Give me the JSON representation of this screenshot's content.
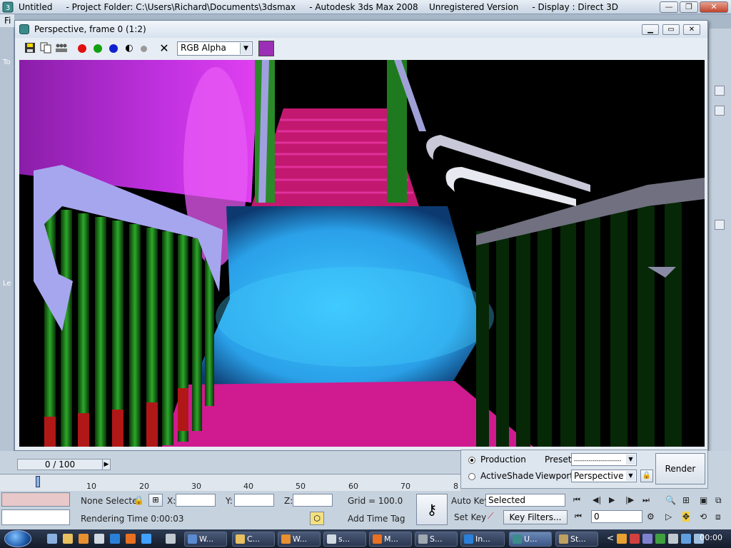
{
  "main_window": {
    "title": "Untitled     - Project Folder: C:\\Users\\Richard\\Documents\\3dsmax     - Autodesk 3ds Max 2008    Unregistered Version     - Display : Direct 3D",
    "menu_stub": "Fi"
  },
  "left_strip_marks": [
    "To",
    "Le"
  ],
  "frame_window": {
    "title": "Perspective, frame 0 (1:2)",
    "channel_select": "RGB Alpha",
    "swatch_color": "#9b2fb5"
  },
  "timeline": {
    "slider_text": "0 / 100",
    "ruler_ticks": [
      "10",
      "20",
      "30",
      "40",
      "50",
      "60",
      "70"
    ],
    "ruler_edge_label": "8"
  },
  "render_panel": {
    "production_label": "Production",
    "activeshade_label": "ActiveShade",
    "preset_label": "Preset:",
    "preset_value": "-----------------------",
    "viewport_label": "Viewport:",
    "viewport_value": "Perspective",
    "render_button": "Render"
  },
  "status": {
    "selection_text": "None Selecte",
    "x_label": "X:",
    "y_label": "Y:",
    "z_label": "Z:",
    "grid_text": "Grid = 100.0",
    "render_time": "Rendering Time  0:00:03",
    "add_time_tag": "Add Time Tag",
    "auto_key": "Auto Key",
    "set_key": "Set Key",
    "selected_dropdown": "Selected",
    "key_filters": "Key Filters...",
    "frame_field": "0"
  },
  "taskbar": {
    "buttons": [
      "W...",
      "C...",
      "W...",
      "s...",
      "M...",
      "S...",
      "In...",
      "U...",
      "St..."
    ],
    "clock": "00:00",
    "tray_chevron": "<"
  }
}
